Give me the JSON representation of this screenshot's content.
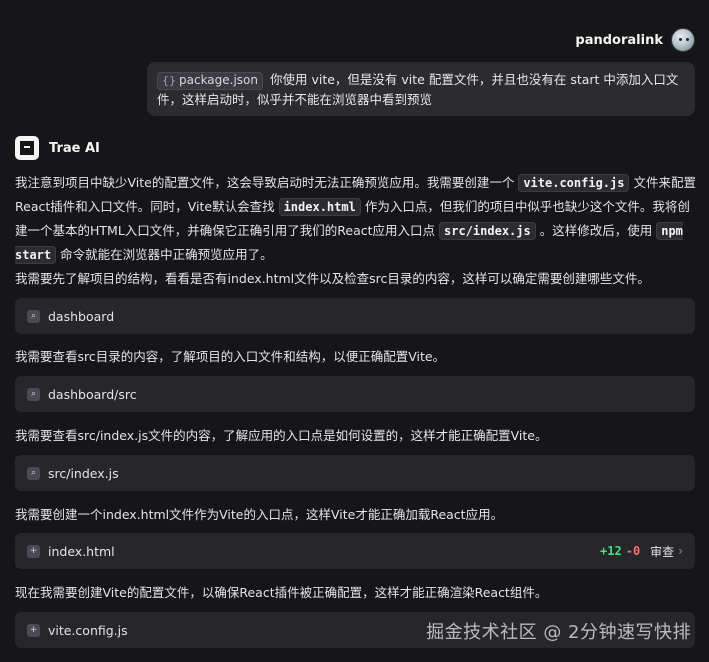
{
  "user": {
    "name": "pandoralink"
  },
  "user_message": {
    "file_chip": "package.json",
    "text": "你使用 vite，但是没有 vite 配置文件，并且也没有在 start 中添加入口文件，这样启动时，似乎并不能在浏览器中看到预览"
  },
  "assistant": {
    "name": "Trae AI",
    "intro": {
      "p1": "我注意到项目中缺少Vite的配置文件，这会导致启动时无法正确预览应用。我需要创建一个",
      "c1": "vite.config.js",
      "p2": "文件来配置React插件和入口文件。同时，Vite默认会查找",
      "c2": "index.html",
      "p3": "作为入口点，但我们的项目中似乎也缺少这个文件。我将创建一个基本的HTML入口文件，并确保它正确引用了我们的React应用入口点",
      "c3": "src/index.js",
      "p4": "。这样修改后，使用",
      "c4": "npm start",
      "p5": "命令就能在浏览器中正确预览应用了。"
    },
    "steps": [
      {
        "text": "我需要先了解项目的结构，看看是否有index.html文件以及检查src目录的内容，这样可以确定需要创建哪些文件。",
        "tool": "dashboard"
      },
      {
        "text": "我需要查看src目录的内容，了解项目的入口文件和结构，以便正确配置Vite。",
        "tool": "dashboard/src"
      },
      {
        "text": "我需要查看src/index.js文件的内容，了解应用的入口点是如何设置的，这样才能正确配置Vite。",
        "tool": "src/index.js"
      },
      {
        "text": "我需要创建一个index.html文件作为Vite的入口点，这样Vite才能正确加载React应用。",
        "tool": "index.html",
        "additions": "+12",
        "deletions": "-0",
        "review": "审查"
      },
      {
        "text": "现在我需要创建Vite的配置文件，以确保React插件被正确配置，这样才能正确渲染React组件。",
        "tool": "vite.config.js"
      }
    ]
  },
  "watermark": "掘金技术社区 @ 2分钟速写快排"
}
